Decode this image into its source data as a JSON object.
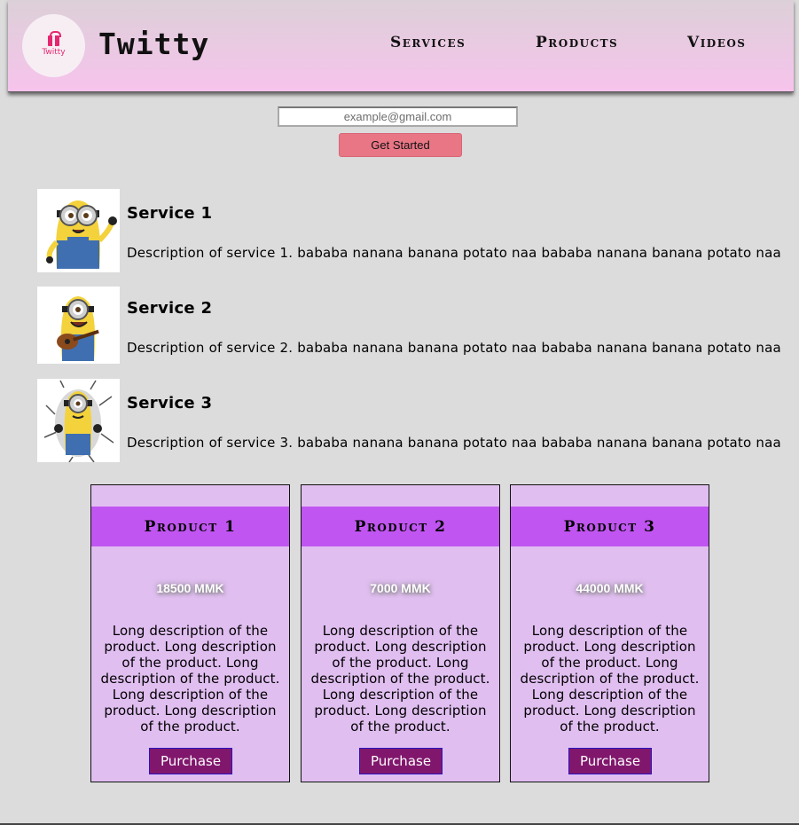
{
  "header": {
    "logo_text": "Twitty",
    "brand": "Twitty",
    "nav": {
      "services": "Services",
      "products": "Products",
      "videos": "Videos"
    }
  },
  "signup": {
    "email_placeholder": "example@gmail.com",
    "button_label": "Get Started"
  },
  "services": [
    {
      "title": "Service 1",
      "description": "Description of service 1. bababa nanana banana potato naa bababa nanana banana potato naa"
    },
    {
      "title": "Service 2",
      "description": "Description of service 2. bababa nanana banana potato naa bababa nanana banana potato naa"
    },
    {
      "title": "Service 3",
      "description": "Description of service 3. bababa nanana banana potato naa bababa nanana banana potato naa"
    }
  ],
  "products": [
    {
      "title": "Product 1",
      "price": "18500 MMK",
      "description": "Long description of the product. Long description of the product. Long description of the product. Long description of the product. Long description of the product.",
      "button_label": "Purchase"
    },
    {
      "title": "Product 2",
      "price": "7000 MMK",
      "description": "Long description of the product. Long description of the product. Long description of the product. Long description of the product. Long description of the product.",
      "button_label": "Purchase"
    },
    {
      "title": "Product 3",
      "price": "44000 MMK",
      "description": "Long description of the product. Long description of the product. Long description of the product. Long description of the product. Long description of the product.",
      "button_label": "Purchase"
    }
  ],
  "colors": {
    "header_gradient_top": "#dcd0d8",
    "header_gradient_bottom": "#f7c3ec",
    "cta": "#e87685",
    "product_card": "#e0bef0",
    "product_header": "#c155f1",
    "purchase_button": "#81176d"
  }
}
